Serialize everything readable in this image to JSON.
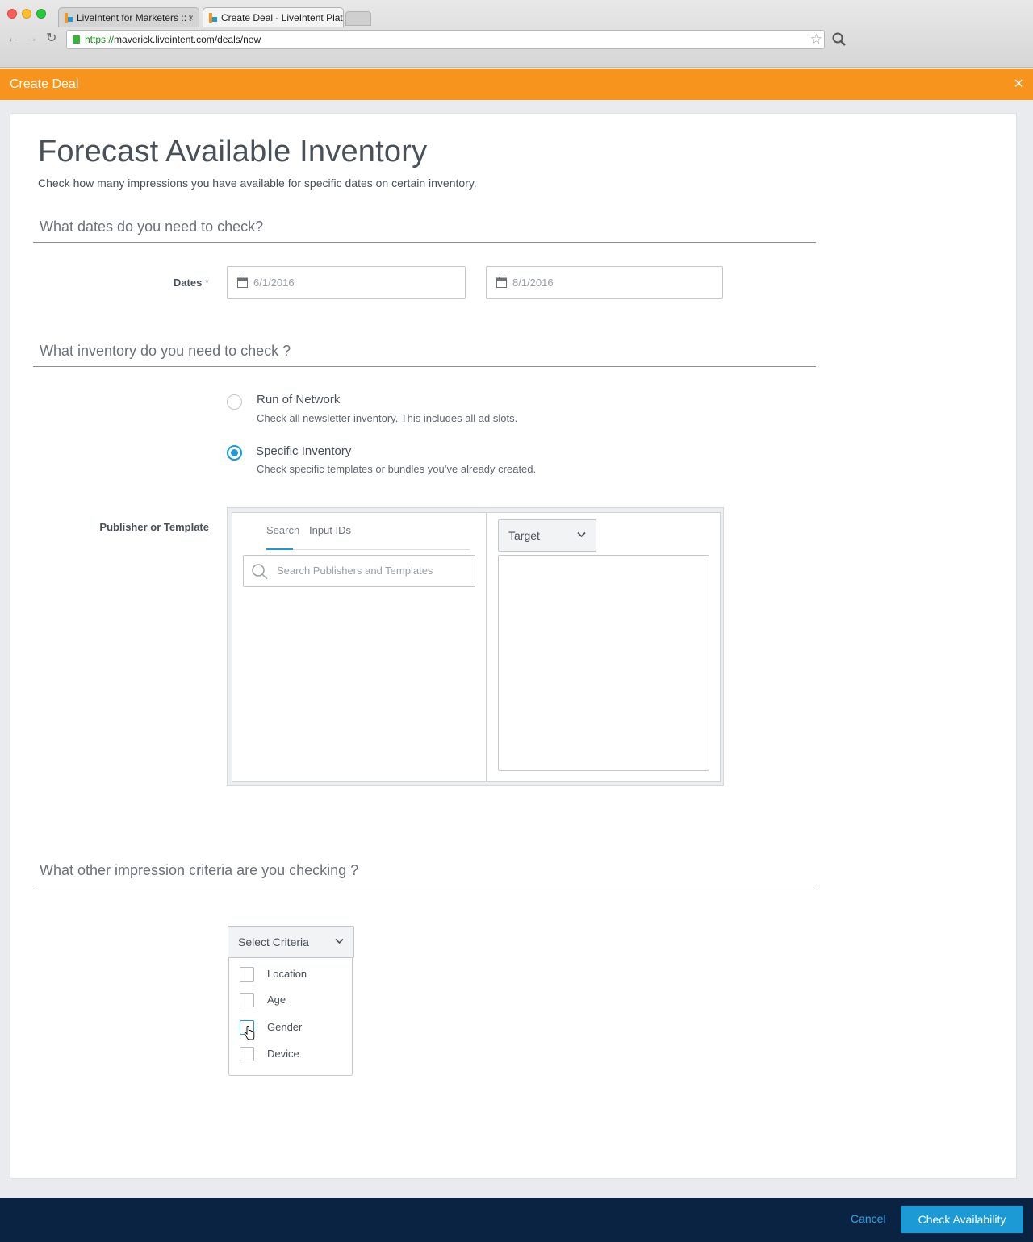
{
  "browser": {
    "tabs": [
      {
        "label": "LiveIntent for Marketers :: :"
      },
      {
        "label": "Create Deal - LiveIntent Platform"
      }
    ],
    "url_scheme": "https://",
    "url_rest": "maverick.liveintent.com/deals/new"
  },
  "header": {
    "title": "Create Deal",
    "close_icon": "×"
  },
  "page": {
    "title": "Forecast Available Inventory",
    "subtitle": "Check how many impressions you have available for specific dates on certain inventory."
  },
  "dates_section": {
    "heading": "What dates do you need to check?",
    "label": "Dates",
    "required_mark": "*",
    "start_date": "6/1/2016",
    "end_date": "8/1/2016"
  },
  "inventory_section": {
    "heading": "What inventory do you need to check ?",
    "options": [
      {
        "title": "Run of Network",
        "description": "Check all newsletter inventory.  This includes all ad slots.",
        "selected": false
      },
      {
        "title": "Specific Inventory",
        "description": "Check specific templates or bundles you’ve already created.",
        "selected": true
      }
    ],
    "publisher_label": "Publisher or Template",
    "tabs": [
      "Search",
      "Input IDs"
    ],
    "active_tab": "Search",
    "search_placeholder": "Search Publishers and Templates",
    "target_select": "Target"
  },
  "criteria_section": {
    "heading": "What other impression criteria are you checking ?",
    "select_label": "Select Criteria",
    "options": [
      {
        "label": "Location",
        "checked": false
      },
      {
        "label": "Age",
        "checked": false
      },
      {
        "label": "Gender",
        "checked": false
      },
      {
        "label": "Device",
        "checked": false
      }
    ]
  },
  "footer": {
    "cancel_label": "Cancel",
    "submit_label": "Check Availability"
  },
  "colors": {
    "header_orange": "#f7941e",
    "accent_blue": "#1b9ad6",
    "footer_navy": "#0b2343"
  }
}
